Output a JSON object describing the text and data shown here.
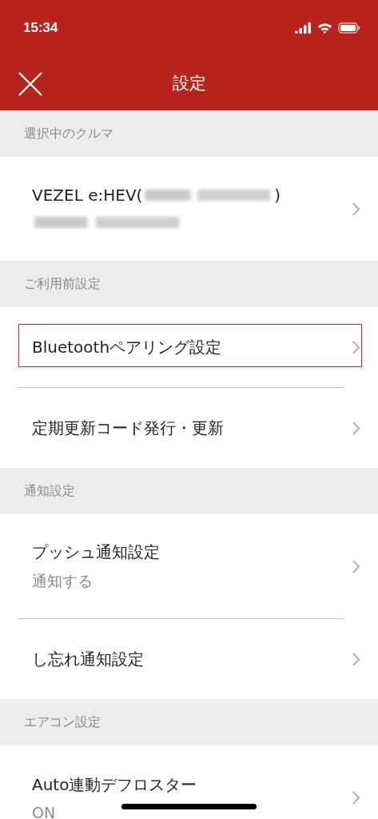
{
  "status_bar": {
    "time": "15:34"
  },
  "nav": {
    "title": "設定"
  },
  "sections": [
    {
      "header": "選択中のクルマ",
      "rows": [
        {
          "title": "VEZEL e:HEV(",
          "title_end": ")",
          "redacted": true,
          "highlighted": false
        }
      ]
    },
    {
      "header": "ご利用前設定",
      "rows": [
        {
          "title": "Bluetoothペアリング設定",
          "highlighted": true
        },
        {
          "title": "定期更新コード発行・更新",
          "highlighted": false
        }
      ]
    },
    {
      "header": "通知設定",
      "rows": [
        {
          "title": "プッシュ通知設定",
          "subtitle": "通知する",
          "highlighted": false
        },
        {
          "title": "し忘れ通知設定",
          "highlighted": false
        }
      ]
    },
    {
      "header": "エアコン設定",
      "rows": [
        {
          "title": "Auto連動デフロスター",
          "subtitle": "ON",
          "highlighted": false
        }
      ]
    }
  ]
}
